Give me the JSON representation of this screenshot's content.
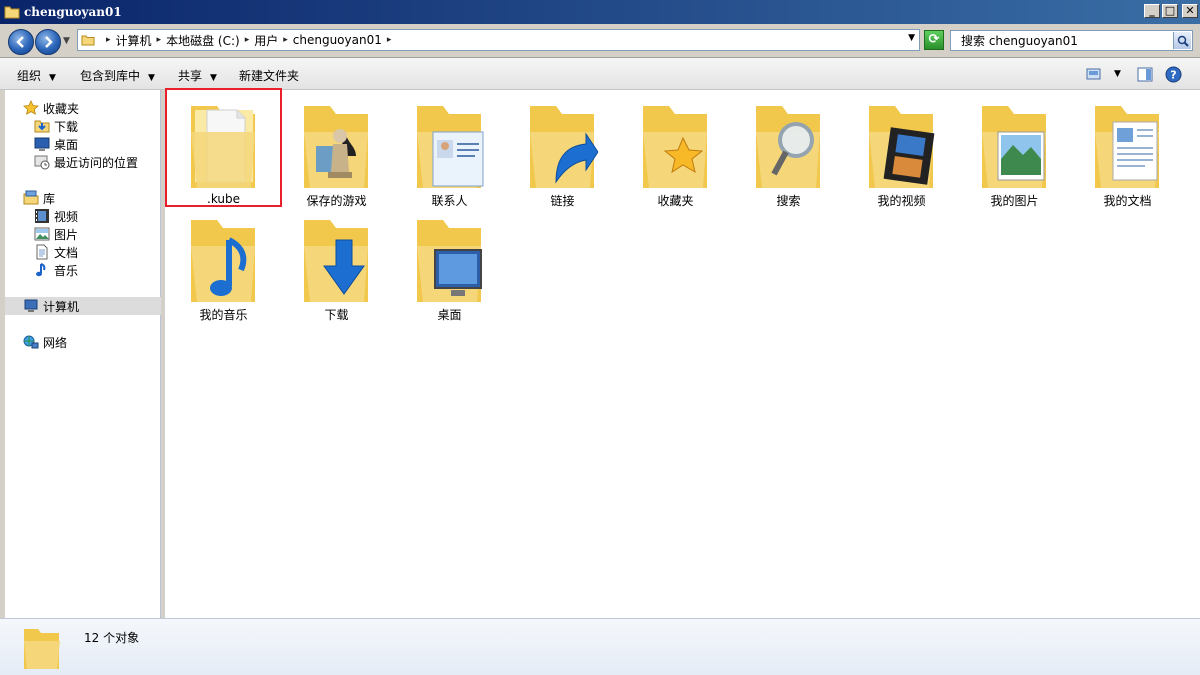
{
  "window": {
    "title": "chenguoyan01",
    "minimize": "_",
    "maximize": "□",
    "close": "✕"
  },
  "address": {
    "crumbs": [
      "计算机",
      "本地磁盘 (C:)",
      "用户",
      "chenguoyan01"
    ],
    "search_placeholder": "搜索 chenguoyan01"
  },
  "toolbar": {
    "organize": "组织",
    "include_in_library": "包含到库中",
    "share": "共享",
    "new_folder": "新建文件夹"
  },
  "sidebar": {
    "favorites": {
      "label": "收藏夹",
      "items": [
        {
          "label": "下载",
          "icon": "download-folder-icon"
        },
        {
          "label": "桌面",
          "icon": "desktop-icon"
        },
        {
          "label": "最近访问的位置",
          "icon": "recent-places-icon"
        }
      ]
    },
    "libraries": {
      "label": "库",
      "items": [
        {
          "label": "视频",
          "icon": "video-icon"
        },
        {
          "label": "图片",
          "icon": "picture-icon"
        },
        {
          "label": "文档",
          "icon": "document-icon"
        },
        {
          "label": "音乐",
          "icon": "music-icon"
        }
      ]
    },
    "computer": {
      "label": "计算机",
      "selected": true
    },
    "network": {
      "label": "网络"
    }
  },
  "files": [
    {
      "label": ".kube",
      "type": "folder-empty",
      "highlighted": true
    },
    {
      "label": "保存的游戏",
      "type": "folder-games"
    },
    {
      "label": "联系人",
      "type": "folder-contacts"
    },
    {
      "label": "链接",
      "type": "folder-links"
    },
    {
      "label": "收藏夹",
      "type": "folder-favorites"
    },
    {
      "label": "搜索",
      "type": "folder-searches"
    },
    {
      "label": "我的视频",
      "type": "folder-videos"
    },
    {
      "label": "我的图片",
      "type": "folder-pictures"
    },
    {
      "label": "我的文档",
      "type": "folder-documents"
    },
    {
      "label": "我的音乐",
      "type": "folder-music"
    },
    {
      "label": "下载",
      "type": "folder-downloads"
    },
    {
      "label": "桌面",
      "type": "folder-desktop"
    }
  ],
  "status": {
    "text": "12 个对象"
  },
  "colors": {
    "title_bar": "#0a246a",
    "highlight_outline": "#e8202a",
    "folder_yellow": "#f5d77a"
  }
}
